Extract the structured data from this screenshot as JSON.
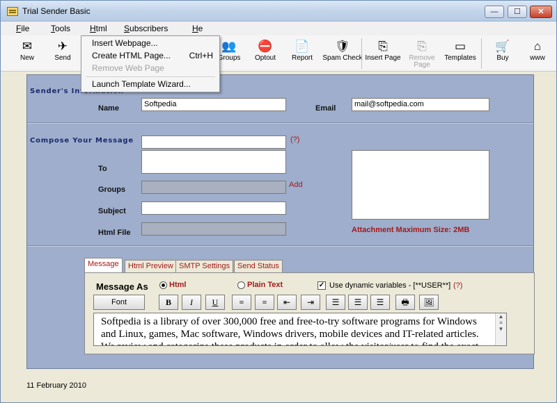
{
  "window": {
    "title": "Trial Sender Basic",
    "min": "—",
    "max": "☐",
    "close": "✕"
  },
  "menu": [
    "File",
    "Tools",
    "Html",
    "Subscribers",
    "He"
  ],
  "html_menu": {
    "items": [
      {
        "label": "Insert Webpage...",
        "shortcut": "",
        "enabled": true
      },
      {
        "label": "Create HTML Page...",
        "shortcut": "Ctrl+H",
        "enabled": true
      },
      {
        "label": "Remove Web Page",
        "shortcut": "",
        "enabled": false
      },
      {
        "label": "Launch Template Wizard...",
        "shortcut": "",
        "enabled": true
      }
    ]
  },
  "toolbar": {
    "items": [
      {
        "label": "New",
        "icon": "✉"
      },
      {
        "label": "Send",
        "icon": "✈"
      },
      {
        "label": "Groups",
        "icon": "👥"
      },
      {
        "label": "Optout",
        "icon": "⛔"
      },
      {
        "label": "Report",
        "icon": "📄"
      },
      {
        "label": "Spam Check",
        "icon": "🛡"
      },
      {
        "label": "Insert Page",
        "icon": "⎘"
      },
      {
        "label": "Remove Page",
        "icon": "⎘"
      },
      {
        "label": "Templates",
        "icon": "▭"
      },
      {
        "label": "Buy",
        "icon": "🛒"
      },
      {
        "label": "www",
        "icon": "⌂"
      }
    ]
  },
  "sender": {
    "section_title": "Sender's Information",
    "name_label": "Name",
    "name_value": "Softpedia",
    "email_label": "Email",
    "email_value": "mail@softpedia.com"
  },
  "compose": {
    "section_title": "Compose Your Message",
    "help_link": "(?)",
    "to_label": "To",
    "groups_label": "Groups",
    "add_link": "Add",
    "subject_label": "Subject",
    "html_file_label": "Html File",
    "attachment_note": "Attachment Maximum Size: 2MB"
  },
  "tabs": [
    "Message",
    "Html Preview",
    "SMTP Settings",
    "Send Status"
  ],
  "message": {
    "format_label": "Message As",
    "html_option": "Html",
    "plain_option": "Plain Text",
    "selected": "Html",
    "dynamic_label": "Use dynamic variables - [**USER**]",
    "dynamic_checked": true,
    "help_link": "(?)",
    "font_button": "Font",
    "format_buttons": [
      "B",
      "I",
      "U",
      "≡",
      "≡",
      "⇤",
      "⇥",
      "☰",
      "☰",
      "☰",
      "🖶",
      "🖼"
    ],
    "body": "Softpedia is a library of over 300,000 free and free-to-try software programs for Windows and Linux, games, Mac software, Windows drivers, mobile devices and IT-related articles. We review and categorize these products in order to allow the visitor/user to find the exact"
  },
  "status": {
    "date": "11 February 2010"
  }
}
